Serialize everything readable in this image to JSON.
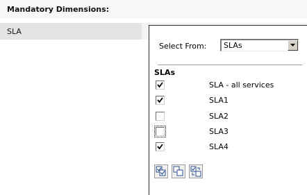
{
  "heading": "Mandatory Dimensions:",
  "dimension_item": "SLA",
  "select_from": {
    "label": "Select From:",
    "value": "SLAs"
  },
  "list_heading": "SLAs",
  "options": [
    {
      "label": "SLA - all services",
      "checked": true
    },
    {
      "label": "SLA1",
      "checked": true
    },
    {
      "label": "SLA2",
      "checked": false
    },
    {
      "label": "SLA3",
      "checked": false,
      "focused": true
    },
    {
      "label": "SLA4",
      "checked": true
    }
  ],
  "buttons": [
    {
      "icon": "select-all-icon"
    },
    {
      "icon": "deselect-all-icon"
    },
    {
      "icon": "invert-selection-icon"
    }
  ]
}
